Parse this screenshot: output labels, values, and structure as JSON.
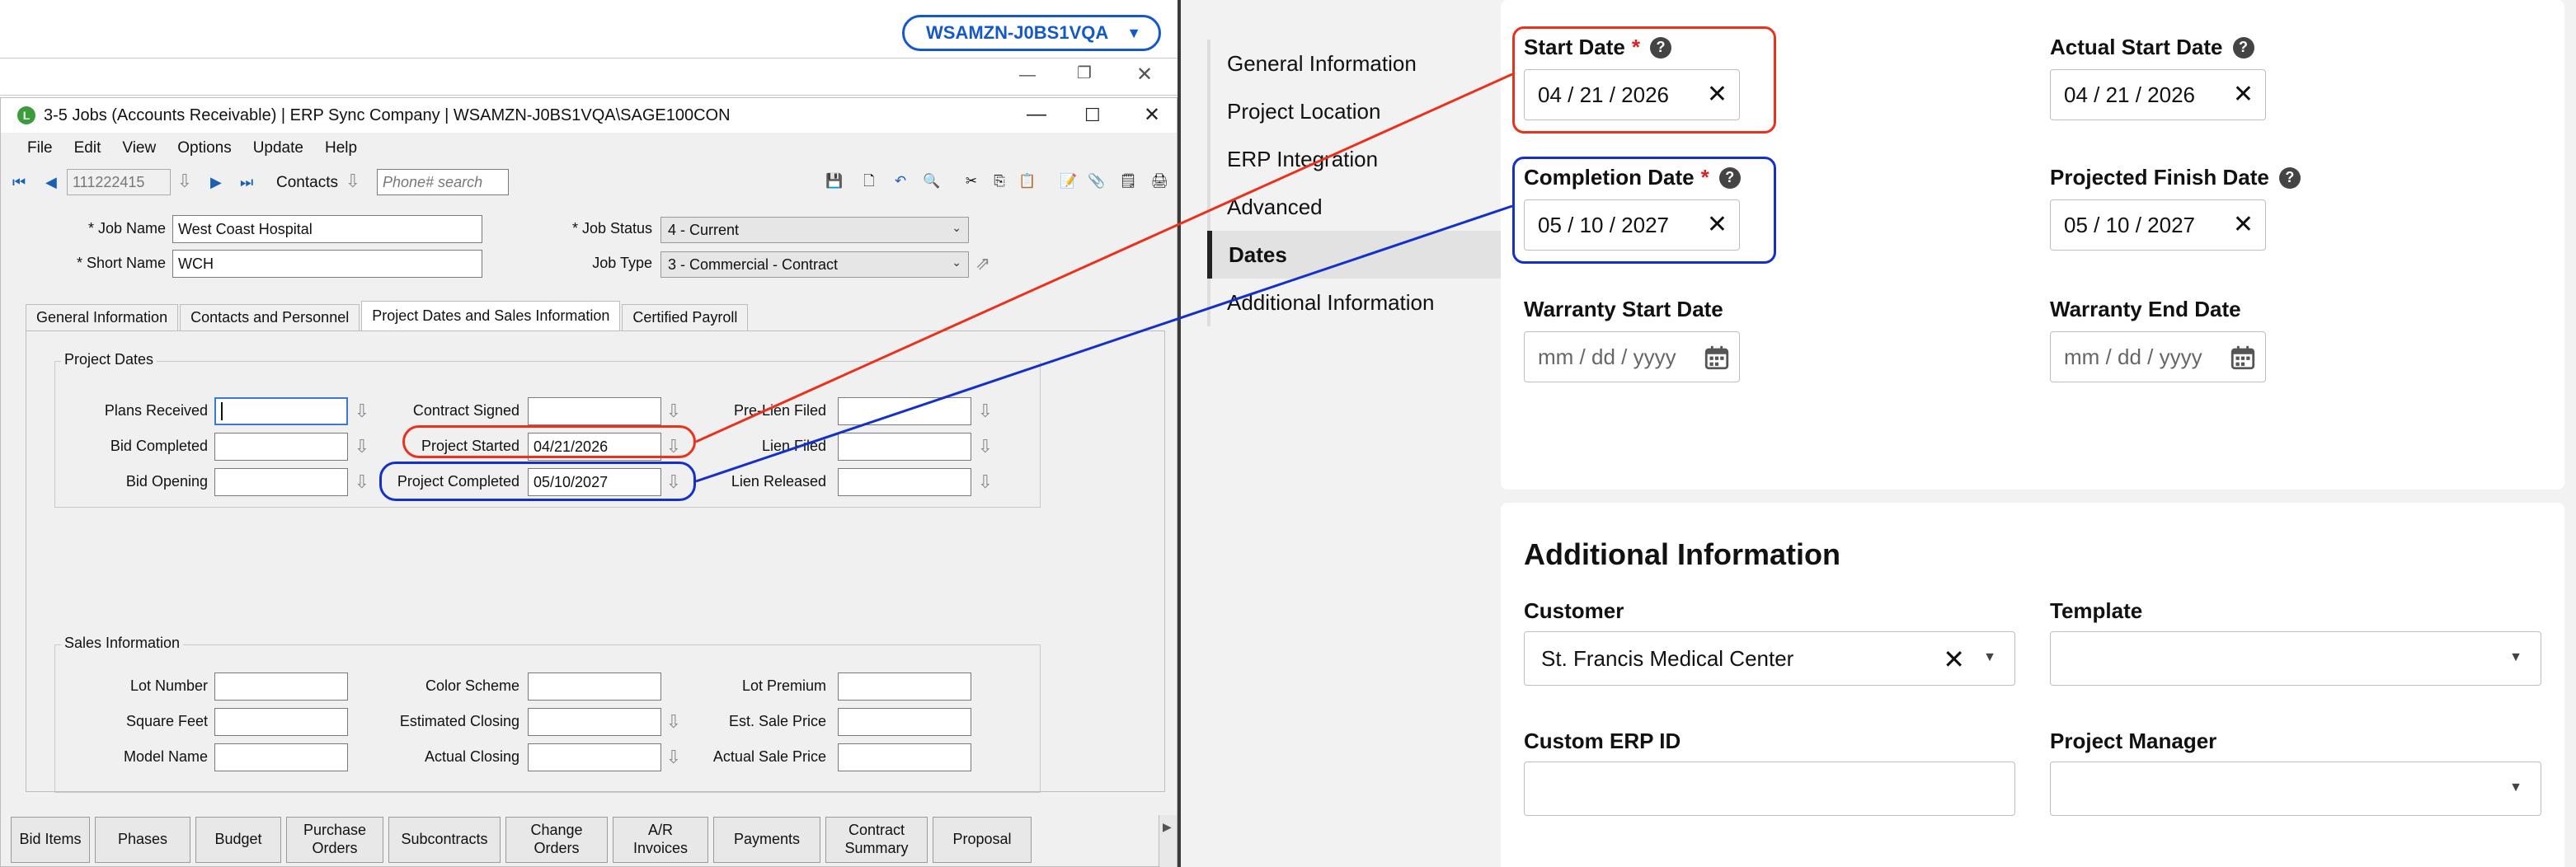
{
  "workspace": {
    "name": "WSAMZN-J0BS1VQA"
  },
  "sage": {
    "window_title": "3-5 Jobs (Accounts Receivable) | ERP Sync Company | WSAMZN-J0BS1VQA\\SAGE100CON",
    "menu": [
      "File",
      "Edit",
      "View",
      "Options",
      "Update",
      "Help"
    ],
    "toolbar": {
      "record": "111222415",
      "contacts_label": "Contacts",
      "phone_placeholder": "Phone# search"
    },
    "header": {
      "job_name_label": "* Job Name",
      "job_name": "West Coast Hospital",
      "short_name_label": "* Short Name",
      "short_name": "WCH",
      "job_status_label": "* Job Status",
      "job_status": "4 - Current",
      "job_type_label": "Job Type",
      "job_type": "3 - Commercial - Contract"
    },
    "tabs": [
      "General Information",
      "Contacts and Personnel",
      "Project Dates and Sales Information",
      "Certified Payroll"
    ],
    "active_tab": "Project Dates and Sales Information",
    "project_dates": {
      "title": "Project Dates",
      "plans_received": "Plans Received",
      "bid_completed": "Bid Completed",
      "bid_opening": "Bid Opening",
      "contract_signed": "Contract Signed",
      "project_started": "Project Started",
      "project_started_value": "04/21/2026",
      "project_completed": "Project Completed",
      "project_completed_value": "05/10/2027",
      "pre_lien_filed": "Pre-Lien Filed",
      "lien_filed": "Lien Filed",
      "lien_released": "Lien Released"
    },
    "sales_info": {
      "title": "Sales Information",
      "lot_number": "Lot Number",
      "square_feet": "Square Feet",
      "model_name": "Model Name",
      "color_scheme": "Color Scheme",
      "estimated_closing": "Estimated Closing",
      "actual_closing": "Actual Closing",
      "lot_premium": "Lot Premium",
      "est_sale_price": "Est. Sale Price",
      "actual_sale_price": "Actual Sale Price"
    },
    "bottom_buttons": [
      {
        "label": "Bid Items",
        "w": 96
      },
      {
        "label": "Phases",
        "w": 116
      },
      {
        "label": "Budget",
        "w": 104
      },
      {
        "label": "Purchase\nOrders",
        "w": 118
      },
      {
        "label": "Subcontracts",
        "w": 136
      },
      {
        "label": "Change\nOrders",
        "w": 124
      },
      {
        "label": "A/R\nInvoices",
        "w": 116
      },
      {
        "label": "Payments",
        "w": 130
      },
      {
        "label": "Contract\nSummary",
        "w": 124
      },
      {
        "label": "Proposal",
        "w": 120
      }
    ]
  },
  "web": {
    "nav": [
      "General Information",
      "Project Location",
      "ERP Integration",
      "Advanced",
      "Dates",
      "Additional Information"
    ],
    "active_nav": "Dates",
    "dates": {
      "start_date_label": "Start Date",
      "start_date": "04 / 21 / 2026",
      "actual_start_label": "Actual Start Date",
      "actual_start": "04 / 21 / 2026",
      "completion_label": "Completion Date",
      "completion": "05 / 10 / 2027",
      "projected_finish_label": "Projected Finish Date",
      "projected_finish": "05 / 10 / 2027",
      "warranty_start_label": "Warranty Start Date",
      "warranty_end_label": "Warranty End Date",
      "empty_placeholder": "mm / dd / yyyy"
    },
    "additional": {
      "title": "Additional Information",
      "customer_label": "Customer",
      "customer": "St. Francis Medical Center",
      "template_label": "Template",
      "custom_erp_label": "Custom ERP ID",
      "project_manager_label": "Project Manager"
    }
  },
  "colors": {
    "red": "#e8321e",
    "blue": "#1530c8",
    "accent": "#1558c8"
  }
}
